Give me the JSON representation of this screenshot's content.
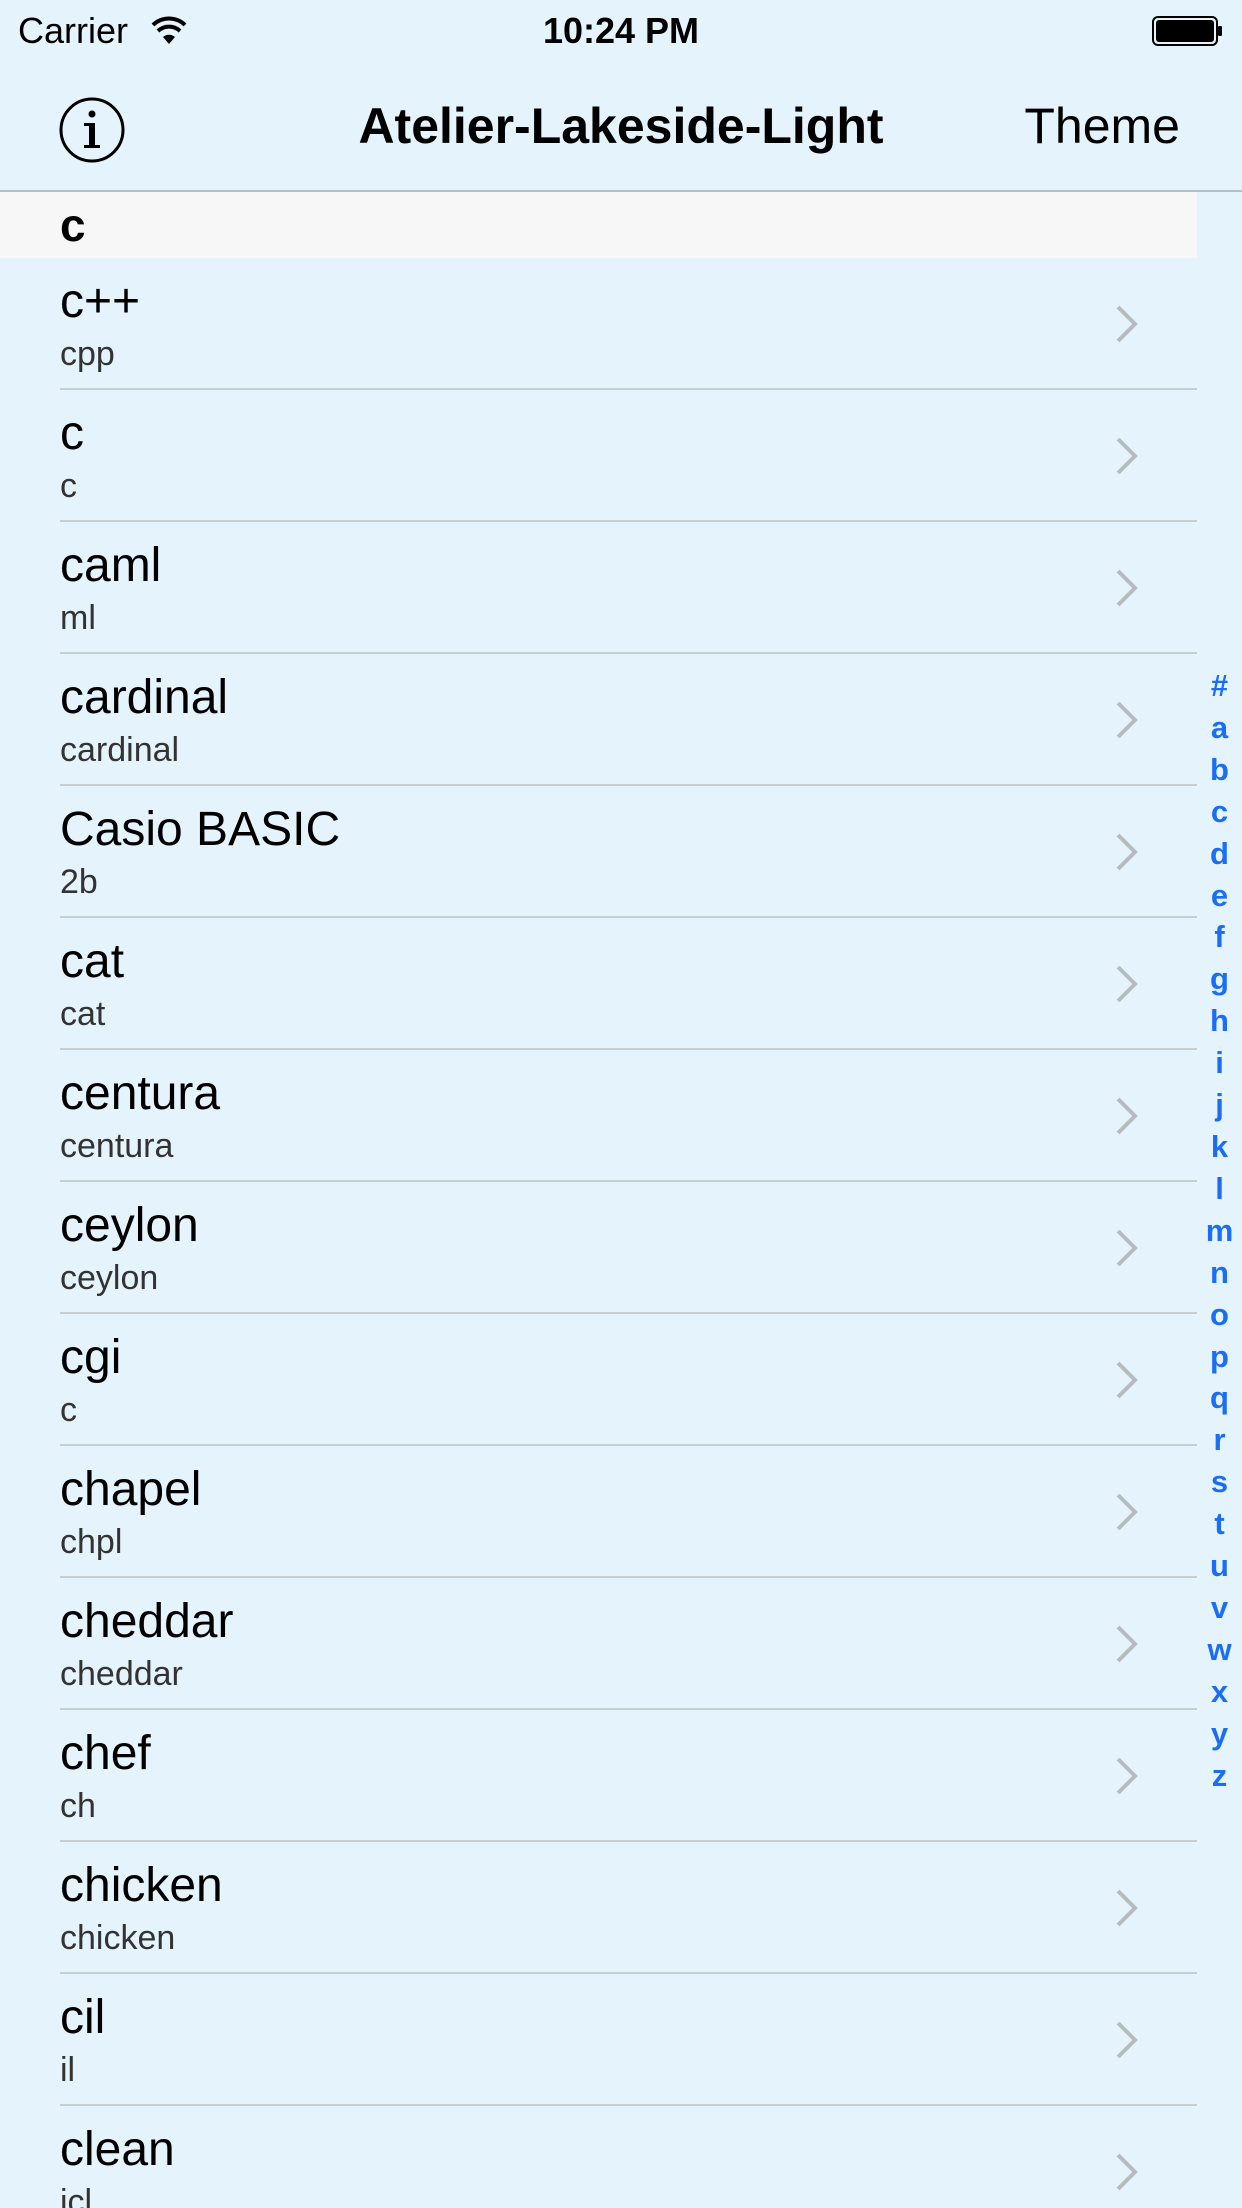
{
  "status_bar": {
    "carrier": "Carrier",
    "time": "10:24 PM"
  },
  "nav": {
    "title": "Atelier-Lakeside-Light",
    "right_button": "Theme",
    "left_icon": "info-icon"
  },
  "section": {
    "header": "c"
  },
  "rows": [
    {
      "title": "c++",
      "subtitle": "cpp"
    },
    {
      "title": "c",
      "subtitle": "c"
    },
    {
      "title": "caml",
      "subtitle": "ml"
    },
    {
      "title": "cardinal",
      "subtitle": "cardinal"
    },
    {
      "title": "Casio BASIC",
      "subtitle": "2b"
    },
    {
      "title": "cat",
      "subtitle": "cat"
    },
    {
      "title": "centura",
      "subtitle": "centura"
    },
    {
      "title": "ceylon",
      "subtitle": "ceylon"
    },
    {
      "title": "cgi",
      "subtitle": "c"
    },
    {
      "title": "chapel",
      "subtitle": "chpl"
    },
    {
      "title": "cheddar",
      "subtitle": "cheddar"
    },
    {
      "title": "chef",
      "subtitle": "ch"
    },
    {
      "title": "chicken",
      "subtitle": "chicken"
    },
    {
      "title": "cil",
      "subtitle": "il"
    },
    {
      "title": "clean",
      "subtitle": "icl"
    }
  ],
  "index": [
    "#",
    "a",
    "b",
    "c",
    "d",
    "e",
    "f",
    "g",
    "h",
    "i",
    "j",
    "k",
    "l",
    "m",
    "n",
    "o",
    "p",
    "q",
    "r",
    "s",
    "t",
    "u",
    "v",
    "w",
    "x",
    "y",
    "z"
  ],
  "colors": {
    "background": "#e5f4fc",
    "section_header": "#f7f7f7",
    "index_accent": "#1b6ef3",
    "chevron": "#b8bcc0"
  }
}
